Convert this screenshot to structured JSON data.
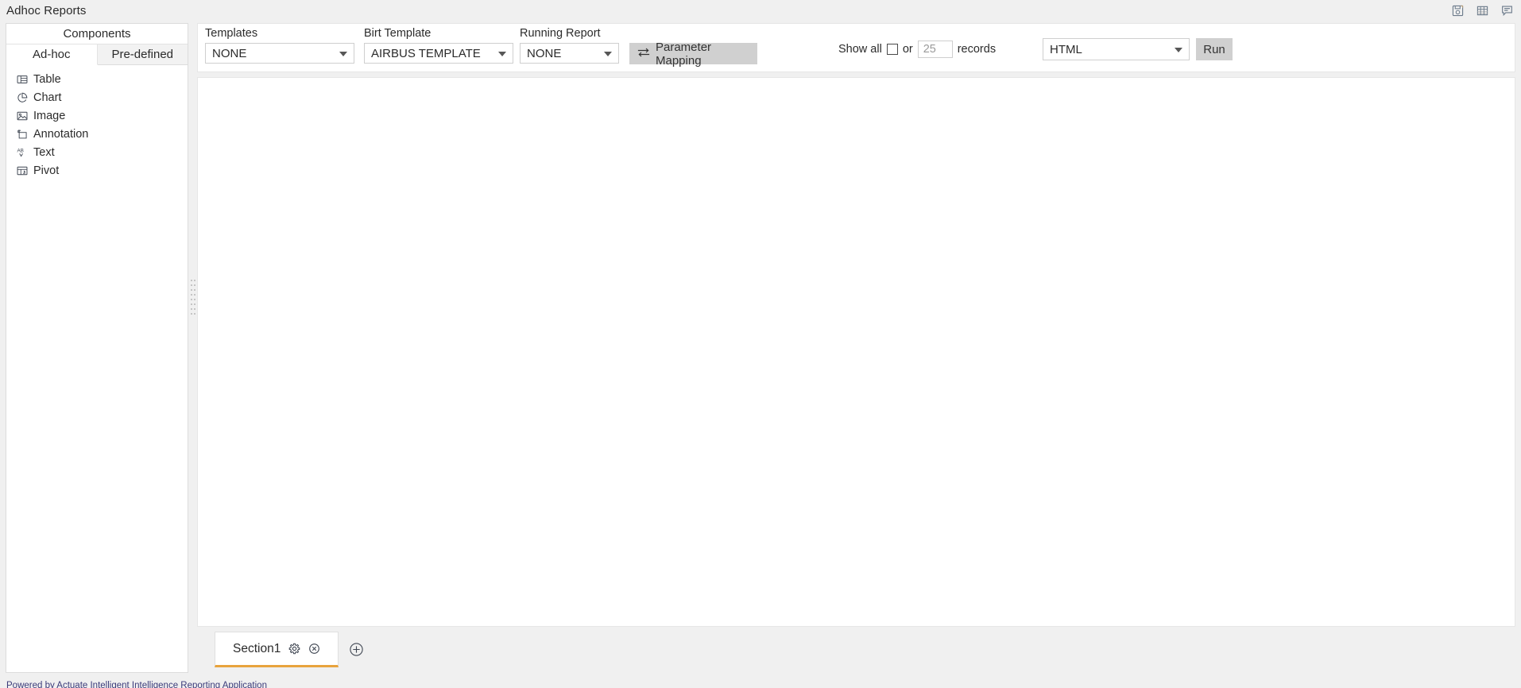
{
  "window": {
    "title": "Adhoc Reports",
    "icons": [
      {
        "name": "save-icon",
        "label": "Save"
      },
      {
        "name": "table-grid-icon",
        "label": "Data Grid"
      },
      {
        "name": "comment-icon",
        "label": "Comments"
      }
    ]
  },
  "sidebar": {
    "header": "Components",
    "tabs": [
      {
        "label": "Ad-hoc",
        "active": true
      },
      {
        "label": "Pre-defined",
        "active": false
      }
    ],
    "items": [
      {
        "label": "Table",
        "icon": "table-icon"
      },
      {
        "label": "Chart",
        "icon": "pie-chart-icon"
      },
      {
        "label": "Image",
        "icon": "image-icon"
      },
      {
        "label": "Annotation",
        "icon": "annotation-icon"
      },
      {
        "label": "Text",
        "icon": "text-ab-icon"
      },
      {
        "label": "Pivot",
        "icon": "pivot-icon"
      }
    ]
  },
  "toolbar": {
    "templates": {
      "label": "Templates",
      "value": "NONE"
    },
    "birt_template": {
      "label": "Birt Template",
      "value": "AIRBUS TEMPLATE"
    },
    "running_report": {
      "label": "Running Report",
      "value": "NONE"
    },
    "parameter_mapping": {
      "label": "Parameter Mapping",
      "icon": "swap-arrows-icon"
    },
    "show_all_label": "Show all",
    "or_label": "or",
    "records_value": "25",
    "records_placeholder": "25",
    "records_label": "records",
    "format": {
      "value": "HTML"
    },
    "run_label": "Run"
  },
  "sections": {
    "tabs": [
      {
        "label": "Section1",
        "active": true
      }
    ],
    "add_label": "+"
  },
  "footer": {
    "text": "Powered by Actuate Intelligent Intelligence Reporting Application"
  },
  "colors": {
    "accent": "#e8a33d",
    "button": "#d0d0d0",
    "background": "#f0f0f0",
    "panel": "#ffffff",
    "border": "#dcdcdc"
  }
}
